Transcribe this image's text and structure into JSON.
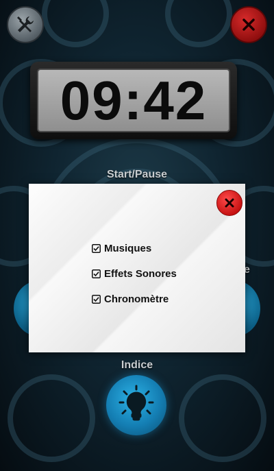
{
  "timer": {
    "value": "09:42"
  },
  "labels": {
    "start_pause": "Start/Pause",
    "side_partial": "e",
    "hint": "Indice"
  },
  "modal": {
    "options": [
      {
        "label": "Musiques",
        "checked": true
      },
      {
        "label": "Effets Sonores",
        "checked": true
      },
      {
        "label": "Chronomètre",
        "checked": true
      }
    ]
  },
  "icons": {
    "settings": "tools-icon",
    "close_top": "close-icon",
    "close_modal": "close-icon",
    "hint": "lightbulb-icon",
    "checkbox": "checkbox-checked-icon"
  },
  "colors": {
    "accent_blue": "#147eb3",
    "close_red": "#c30f0f",
    "background": "#0f2430"
  }
}
